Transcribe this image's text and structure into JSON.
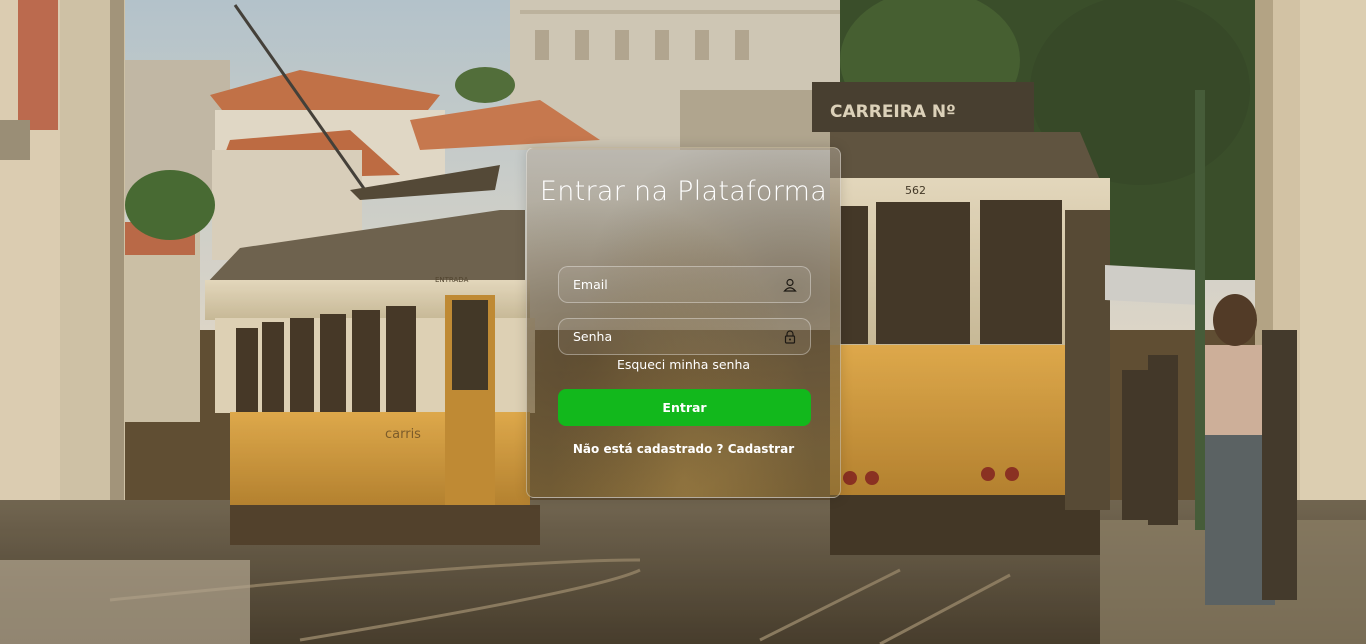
{
  "login": {
    "title": "Entrar na Plataforma",
    "email_placeholder": "Email",
    "password_placeholder": "Senha",
    "forgot_password": "Esqueci minha senha",
    "submit_label": "Entrar",
    "register_prompt": "Não está cadastrado ?",
    "register_link": "Cadastrar"
  },
  "background": {
    "tram_sign": "CARREIRA Nº",
    "tram_number": "562",
    "tram_logo": "carris",
    "tram_left_label": "ENTRADA"
  },
  "icons": {
    "email": "user-icon",
    "password": "lock-icon"
  },
  "colors": {
    "submit_button": "#12b81c",
    "text": "#ffffff"
  }
}
